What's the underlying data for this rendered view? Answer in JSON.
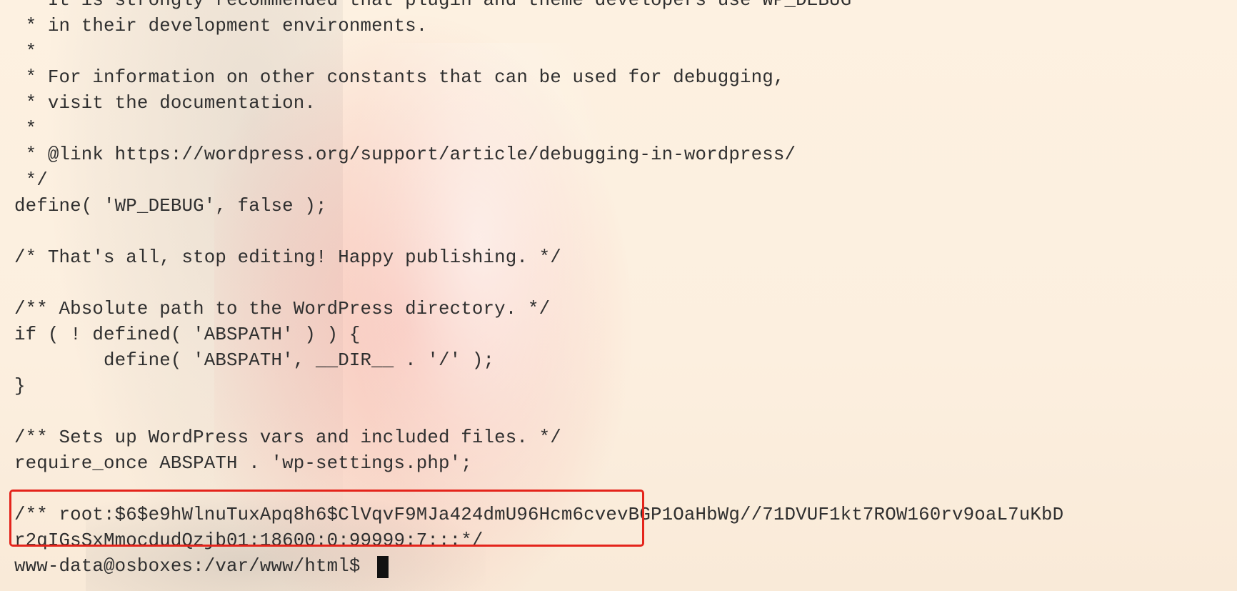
{
  "terminal": {
    "lines": [
      " * It is strongly recommended that plugin and theme developers use WP_DEBUG",
      " * in their development environments.",
      " *",
      " * For information on other constants that can be used for debugging,",
      " * visit the documentation.",
      " *",
      " * @link https://wordpress.org/support/article/debugging-in-wordpress/",
      " */",
      "define( 'WP_DEBUG', false );",
      "",
      "/* That's all, stop editing! Happy publishing. */",
      "",
      "/** Absolute path to the WordPress directory. */",
      "if ( ! defined( 'ABSPATH' ) ) {",
      "        define( 'ABSPATH', __DIR__ . '/' );",
      "}",
      "",
      "/** Sets up WordPress vars and included files. */",
      "require_once ABSPATH . 'wp-settings.php';",
      "",
      "/** root:$6$e9hWlnuTuxApq8h6$ClVqvF9MJa424dmU96Hcm6cvevBGP1OaHbWg//71DVUF1kt7ROW160rv9oaL7uKbD",
      "r2qIGsSxMmocdudQzjb01:18600:0:99999:7:::*/"
    ],
    "prompt": "www-data@osboxes:/var/www/html$ "
  },
  "colors": {
    "background": "#fcefdf",
    "text": "#2f2f2f",
    "highlight_border": "#e4241b",
    "cursor": "#111111"
  }
}
